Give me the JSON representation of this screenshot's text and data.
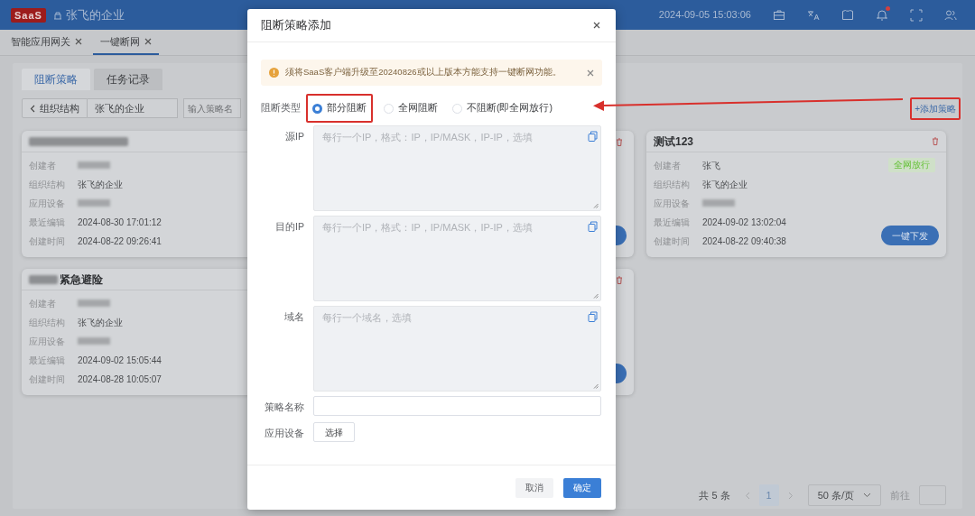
{
  "header": {
    "logo": "SaaS",
    "org": "张飞的企业",
    "datetime": "2024-09-05 15:03:06",
    "unread": true
  },
  "page_tabs": [
    {
      "label": "智能应用网关",
      "selected": false
    },
    {
      "label": "一键断网",
      "selected": true
    }
  ],
  "sub_tabs": [
    {
      "label": "阻断策略",
      "selected": true
    },
    {
      "label": "任务记录",
      "selected": false
    }
  ],
  "toolbar": {
    "back": "组织结构",
    "org": "张飞的企业",
    "search_placeholder": "输入策略名",
    "add_link": "+添加策略"
  },
  "cards": [
    {
      "title_blurred": true,
      "rows": [
        {
          "label": "创建者",
          "kind": "blurred"
        },
        {
          "label": "组织结构",
          "kind": "text",
          "value": "张飞的企业"
        },
        {
          "label": "应用设备",
          "kind": "blurred"
        },
        {
          "label": "最近编辑",
          "kind": "text",
          "value": "2024-08-30 17:01:12"
        },
        {
          "label": "创建时间",
          "kind": "text",
          "value": "2024-08-22 09:26:41"
        }
      ]
    },
    {
      "title": "测试123",
      "title_blurred": false,
      "tag": {
        "label": "全网放行",
        "color": "#67c23a"
      },
      "button": "一键下发",
      "rows": [
        {
          "label": "创建者",
          "kind": "text",
          "value": "张飞"
        },
        {
          "label": "组织结构",
          "kind": "text",
          "value": "张飞的企业"
        },
        {
          "label": "应用设备",
          "kind": "blurred"
        },
        {
          "label": "最近编辑",
          "kind": "text",
          "value": "2024-09-02 13:02:04"
        },
        {
          "label": "创建时间",
          "kind": "text",
          "value": "2024-08-22 09:40:38"
        }
      ]
    },
    {
      "title": "紧急避险",
      "title_blurred": true,
      "rows": [
        {
          "label": "创建者",
          "kind": "blurred"
        },
        {
          "label": "组织结构",
          "kind": "text",
          "value": "张飞的企业"
        },
        {
          "label": "应用设备",
          "kind": "blurred"
        },
        {
          "label": "最近编辑",
          "kind": "text",
          "value": "2024-09-02 15:05:44"
        },
        {
          "label": "创建时间",
          "kind": "text",
          "value": "2024-08-28 10:05:07"
        }
      ]
    }
  ],
  "pagination": {
    "total": "共 5 条",
    "pages": [
      {
        "label": "1",
        "selected": true
      }
    ],
    "page_size": "50 条/页",
    "goto": "前往"
  },
  "dialog": {
    "title": "阻断策略添加",
    "alert": "须将SaaS客户端升级至20240826或以上版本方能支持一键断网功能。",
    "block_type": {
      "label": "阻断类型",
      "options": [
        {
          "label": "部分阻断",
          "selected": true
        },
        {
          "label": "全网阻断",
          "selected": false
        },
        {
          "label": "不阻断(即全网放行)",
          "selected": false
        }
      ]
    },
    "fields": [
      {
        "label": "源IP",
        "kind": "textarea",
        "placeholder": "每行一个IP，格式：IP，IP/MASK，IP-IP，选填"
      },
      {
        "label": "目的IP",
        "kind": "textarea",
        "placeholder": "每行一个IP，格式：IP，IP/MASK，IP-IP，选填"
      },
      {
        "label": "域名",
        "kind": "textarea",
        "placeholder": "每行一个域名，选填"
      },
      {
        "label": "策略名称",
        "kind": "input"
      },
      {
        "label": "应用设备",
        "kind": "button",
        "button": "选择"
      }
    ],
    "buttons": [
      {
        "label": "取消",
        "kind": "secondary"
      },
      {
        "label": "确定",
        "kind": "primary"
      }
    ]
  }
}
